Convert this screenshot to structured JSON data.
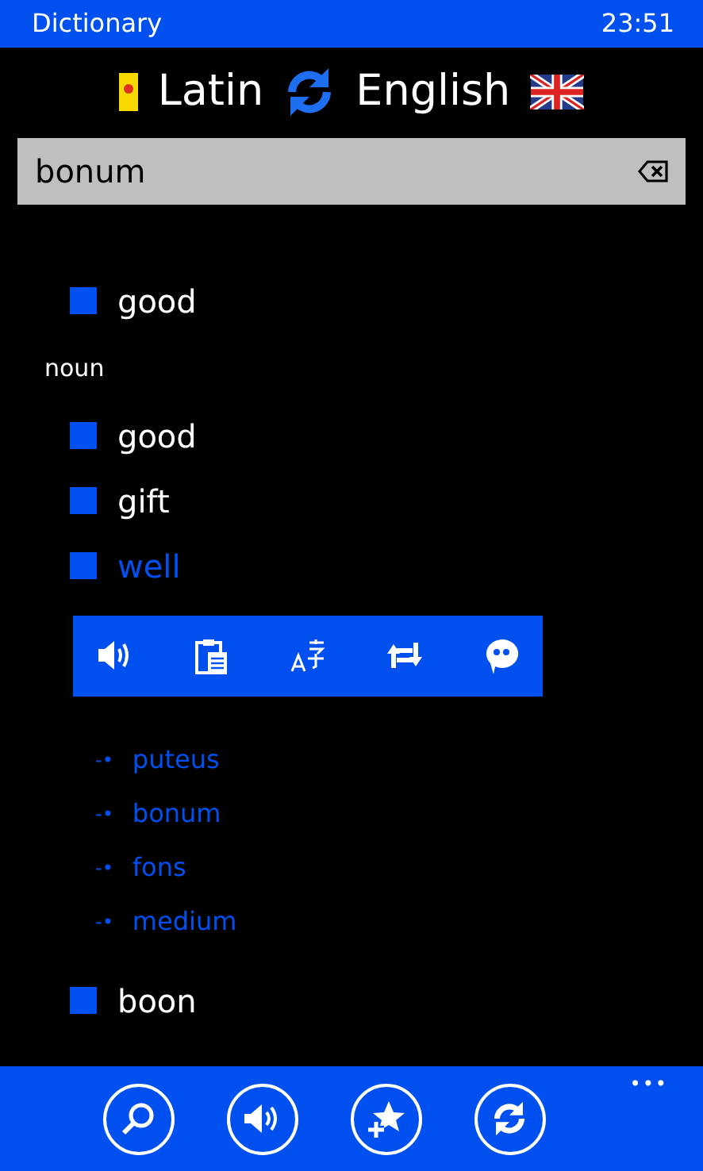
{
  "status_bar": {
    "title": "Dictionary",
    "time": "23:51"
  },
  "languages": {
    "source": "Latin",
    "target": "English"
  },
  "search": {
    "value": "bonum"
  },
  "entries": [
    {
      "kind": "word",
      "text": "good",
      "selected": false
    },
    {
      "kind": "part_of_speech",
      "text": "noun"
    },
    {
      "kind": "word",
      "text": "good",
      "selected": false
    },
    {
      "kind": "word",
      "text": "gift",
      "selected": false
    },
    {
      "kind": "word",
      "text": "well",
      "selected": true,
      "synonyms": [
        {
          "marker": "-•",
          "text": "puteus"
        },
        {
          "marker": "-•",
          "text": "bonum"
        },
        {
          "marker": "-•",
          "text": "fons"
        },
        {
          "marker": "-•",
          "text": "medium"
        }
      ]
    },
    {
      "kind": "word",
      "text": "boon",
      "selected": false
    }
  ],
  "app_bar": {
    "more": "•••"
  }
}
